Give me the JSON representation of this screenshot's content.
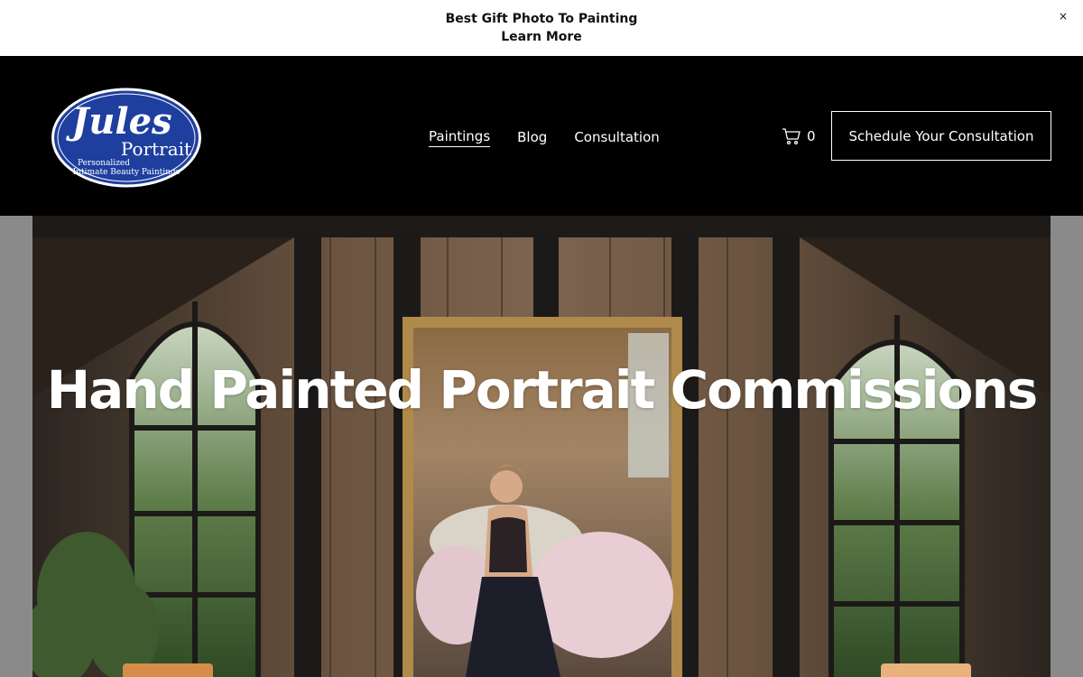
{
  "announcement": {
    "line1": "Best Gift Photo To Painting",
    "line2": "Learn More",
    "close": "×"
  },
  "logo": {
    "name": "Jules",
    "sub": "Portrait",
    "tagline1": "Personalized",
    "tagline2": "Intimate Beauty Paintings"
  },
  "nav": {
    "items": [
      {
        "label": "Paintings",
        "active": true
      },
      {
        "label": "Blog",
        "active": false
      },
      {
        "label": "Consultation",
        "active": false
      }
    ]
  },
  "cart": {
    "icon": "cart-icon",
    "count": "0"
  },
  "cta": {
    "label": "Schedule Your Consultation"
  },
  "hero": {
    "title": "Hand Painted Portrait Commissions"
  },
  "colors": {
    "header_bg": "#000000",
    "announce_bg": "#ffffff",
    "logo_blue": "#1f3f9e"
  }
}
